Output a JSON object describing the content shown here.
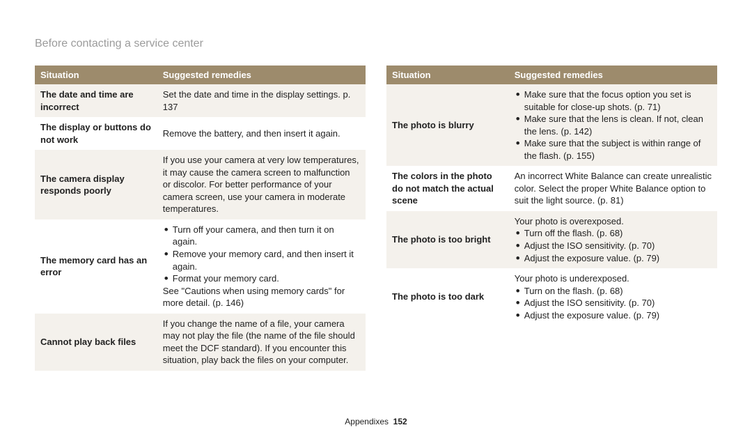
{
  "header": {
    "section_title": "Before contacting a service center"
  },
  "table_headers": {
    "situation": "Situation",
    "remedies": "Suggested remedies"
  },
  "left_rows": [
    {
      "alt": true,
      "situation": "The date and time are incorrect",
      "lines": [
        {
          "bullet": false,
          "text": "Set the date and time in the display settings. p. 137"
        }
      ]
    },
    {
      "alt": false,
      "situation": "The display or buttons do not work",
      "lines": [
        {
          "bullet": false,
          "text": "Remove the battery, and then insert it again."
        }
      ]
    },
    {
      "alt": true,
      "situation": "The camera display responds poorly",
      "lines": [
        {
          "bullet": false,
          "text": "If you use your camera at very low temperatures, it may cause the camera screen to malfunction or discolor. For better performance of your camera screen, use your camera in moderate temperatures."
        }
      ]
    },
    {
      "alt": false,
      "situation": "The memory card has an error",
      "lines": [
        {
          "bullet": true,
          "text": "Turn off your camera, and then turn it on again."
        },
        {
          "bullet": true,
          "text": "Remove your memory card, and then insert it again."
        },
        {
          "bullet": true,
          "text": "Format your memory card."
        },
        {
          "bullet": false,
          "text": "See \"Cautions when using memory cards\" for more detail. (p. 146)"
        }
      ]
    },
    {
      "alt": true,
      "situation": "Cannot play back files",
      "lines": [
        {
          "bullet": false,
          "text": "If you change the name of a file, your camera may not play the file (the name of the file should meet the DCF standard). If you encounter this situation, play back the files on your computer."
        }
      ]
    }
  ],
  "right_rows": [
    {
      "alt": true,
      "situation": "The photo is blurry",
      "lines": [
        {
          "bullet": true,
          "text": "Make sure that the focus option you set is suitable for close-up shots. (p. 71)"
        },
        {
          "bullet": true,
          "text": "Make sure that the lens is clean. If not, clean the lens. (p. 142)"
        },
        {
          "bullet": true,
          "text": "Make sure that the subject is within range of the flash. (p. 155)"
        }
      ]
    },
    {
      "alt": false,
      "situation": "The colors in the photo do not match the actual scene",
      "lines": [
        {
          "bullet": false,
          "text": "An incorrect White Balance can create unrealistic color. Select the proper White Balance option to suit the light source. (p. 81)"
        }
      ]
    },
    {
      "alt": true,
      "situation": "The photo is too bright",
      "lines": [
        {
          "bullet": false,
          "text": "Your photo is overexposed."
        },
        {
          "bullet": true,
          "text": "Turn off the flash. (p. 68)"
        },
        {
          "bullet": true,
          "text": "Adjust the ISO sensitivity. (p. 70)"
        },
        {
          "bullet": true,
          "text": "Adjust the exposure value. (p. 79)"
        }
      ]
    },
    {
      "alt": false,
      "situation": "The photo is too dark",
      "lines": [
        {
          "bullet": false,
          "text": "Your photo is underexposed."
        },
        {
          "bullet": true,
          "text": "Turn on the flash. (p. 68)"
        },
        {
          "bullet": true,
          "text": "Adjust the ISO sensitivity. (p. 70)"
        },
        {
          "bullet": true,
          "text": "Adjust the exposure value. (p. 79)"
        }
      ]
    }
  ],
  "footer": {
    "label": "Appendixes",
    "page": "152"
  }
}
